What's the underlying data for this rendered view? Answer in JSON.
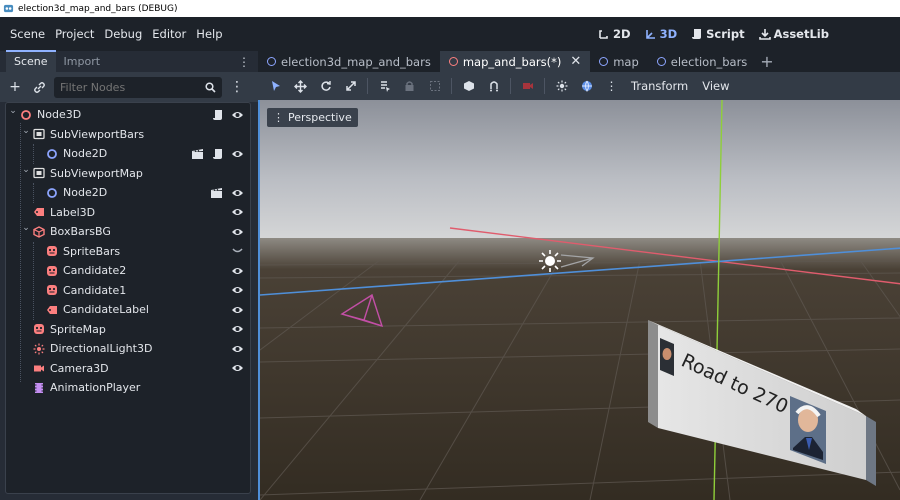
{
  "window": {
    "title": "election3d_map_and_bars (DEBUG)"
  },
  "menubar": {
    "items": [
      "Scene",
      "Project",
      "Debug",
      "Editor",
      "Help"
    ],
    "modes": [
      {
        "label": "2D",
        "icon": "2d-icon",
        "active": false
      },
      {
        "label": "3D",
        "icon": "3d-icon",
        "active": true
      },
      {
        "label": "Script",
        "icon": "script-icon",
        "active": false
      },
      {
        "label": "AssetLib",
        "icon": "assetlib-icon",
        "active": false
      }
    ]
  },
  "dock": {
    "tabs": [
      "Scene",
      "Import"
    ],
    "filter_placeholder": "Filter Nodes"
  },
  "tree": [
    {
      "label": "Node3D",
      "icon": "node3d-icon",
      "depth": 0,
      "expanded": true,
      "badges": [
        "script-icon",
        "visibility-icon"
      ]
    },
    {
      "label": "SubViewportBars",
      "icon": "subviewport-icon",
      "depth": 1,
      "expanded": true,
      "badges": []
    },
    {
      "label": "Node2D",
      "icon": "node2d-icon",
      "depth": 2,
      "expanded": null,
      "badges": [
        "clapper-icon",
        "script-icon",
        "visibility-icon"
      ]
    },
    {
      "label": "SubViewportMap",
      "icon": "subviewport-icon",
      "depth": 1,
      "expanded": true,
      "badges": []
    },
    {
      "label": "Node2D",
      "icon": "node2d-icon",
      "depth": 2,
      "expanded": null,
      "badges": [
        "clapper-icon",
        "visibility-icon"
      ]
    },
    {
      "label": "Label3D",
      "icon": "label3d-icon",
      "depth": 1,
      "expanded": null,
      "badges": [
        "visibility-icon"
      ]
    },
    {
      "label": "BoxBarsBG",
      "icon": "meshinstance-icon",
      "depth": 1,
      "expanded": true,
      "badges": [
        "visibility-icon"
      ]
    },
    {
      "label": "SpriteBars",
      "icon": "sprite3d-icon",
      "depth": 2,
      "expanded": null,
      "badges": [
        "visibility-hidden-icon"
      ]
    },
    {
      "label": "Candidate2",
      "icon": "sprite3d-icon",
      "depth": 2,
      "expanded": null,
      "badges": [
        "visibility-icon"
      ]
    },
    {
      "label": "Candidate1",
      "icon": "sprite3d-icon",
      "depth": 2,
      "expanded": null,
      "badges": [
        "visibility-icon"
      ]
    },
    {
      "label": "CandidateLabel",
      "icon": "label3d-icon",
      "depth": 2,
      "expanded": null,
      "badges": [
        "visibility-icon"
      ]
    },
    {
      "label": "SpriteMap",
      "icon": "sprite3d-icon",
      "depth": 1,
      "expanded": null,
      "badges": [
        "visibility-icon"
      ]
    },
    {
      "label": "DirectionalLight3D",
      "icon": "light-icon",
      "depth": 1,
      "expanded": null,
      "badges": [
        "visibility-icon"
      ]
    },
    {
      "label": "Camera3D",
      "icon": "camera-icon",
      "depth": 1,
      "expanded": null,
      "badges": [
        "visibility-icon"
      ]
    },
    {
      "label": "AnimationPlayer",
      "icon": "animation-icon",
      "depth": 1,
      "expanded": null,
      "badges": []
    }
  ],
  "editor_tabs": [
    {
      "label": "election3d_map_and_bars",
      "active": false,
      "dot": "blue",
      "closable": false
    },
    {
      "label": "map_and_bars(*)",
      "active": true,
      "dot": "red",
      "closable": true
    },
    {
      "label": "map",
      "active": false,
      "dot": "blue",
      "closable": false
    },
    {
      "label": "election_bars",
      "active": false,
      "dot": "blue",
      "closable": false
    }
  ],
  "viewport_toolbar": {
    "menus": [
      "Transform",
      "View"
    ]
  },
  "viewport": {
    "perspective_label": "Perspective",
    "sign_text": "Road to 270"
  },
  "colors": {
    "accent": "#8fb2ff",
    "x_axis": "#e05c6d",
    "z_axis": "#4f8fd9",
    "y_axis": "#8fcf3a",
    "ground": "#3a3226",
    "sky_top": "#8c9099"
  }
}
